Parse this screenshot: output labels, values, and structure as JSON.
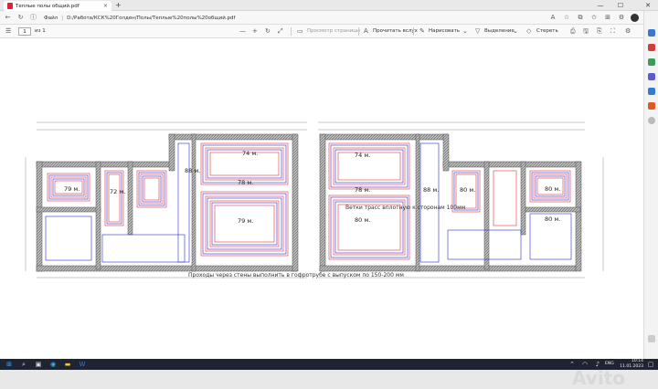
{
  "tab": {
    "title": "Теплые полы общий.pdf",
    "close": "×",
    "new": "+"
  },
  "window": {
    "minimize": "—",
    "maximize": "☐",
    "close": "✕"
  },
  "address": {
    "label": "Файл",
    "url": "D:/Работа/КСК%20Голден/Полы/Теплые%20полы%20общий.pdf"
  },
  "toolbar": {
    "menu": "☰",
    "page_current": "1",
    "page_total": "из 1",
    "zoom_out": "—",
    "zoom_in": "+",
    "page_view": "Просмотр страницы",
    "read_aloud": "Прочитать вслух",
    "draw": "Нарисовать",
    "highlight": "Выделение",
    "erase": "Стереть"
  },
  "drawing": {
    "rooms": [
      {
        "label": "79 м."
      },
      {
        "label": "72 м."
      },
      {
        "label": "74 м."
      },
      {
        "label": "78 м."
      },
      {
        "label": "79 м."
      },
      {
        "label": "88 м."
      },
      {
        "label": "74 м."
      },
      {
        "label": "78 м."
      },
      {
        "label": "80 м."
      },
      {
        "label": "88 м."
      },
      {
        "label": "80 м."
      },
      {
        "label": "80 м."
      },
      {
        "label": "80 м."
      }
    ],
    "note_branches": "Ветки трасс вплотную к сторонам 100мм",
    "note_passages": "Проходы через стены выполнить в гофротрубе с выпуском по 150-200 мм"
  },
  "taskbar": {
    "lang": "ENG",
    "time": "10:14",
    "date": "11.01.2023"
  },
  "watermark": "Avito",
  "colors": {
    "heating_red": "#e0323a",
    "heating_blue": "#2b2bd6",
    "wall": "#555555"
  }
}
